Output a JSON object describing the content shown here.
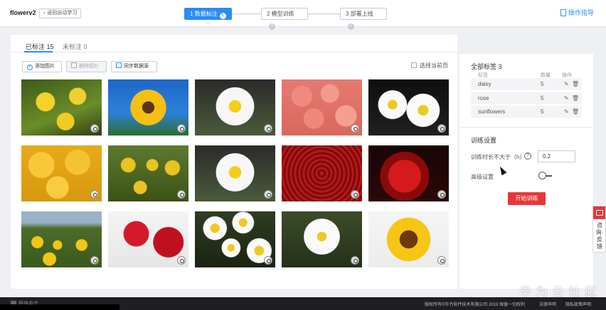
{
  "app": {
    "title": "flowerv2",
    "back_label": "返回自动学习"
  },
  "steps": [
    {
      "label": "1 数据标注",
      "state": "active"
    },
    {
      "label": "2 模型训练",
      "state": "idle"
    },
    {
      "label": "3 部署上线",
      "state": "idle"
    }
  ],
  "guide_label": "操作指导",
  "tabs": {
    "labeled": "已标注 15",
    "unlabeled": "未标注 0"
  },
  "toolbar": {
    "add": "添加图片",
    "delete": "删除图片",
    "sync": "同步数据源",
    "select_page": "选择当前页"
  },
  "images": [
    {
      "kind": "sunflower",
      "style": "t-sun2"
    },
    {
      "kind": "sunflower",
      "style": "t-sun"
    },
    {
      "kind": "daisy",
      "style": "t-daisy"
    },
    {
      "kind": "rose",
      "style": "t-rose-pink"
    },
    {
      "kind": "daisy",
      "style": "t-daisy2"
    },
    {
      "kind": "rose",
      "style": "t-rose-yellow"
    },
    {
      "kind": "sunflower",
      "style": "t-field2"
    },
    {
      "kind": "daisy",
      "style": "t-daisy"
    },
    {
      "kind": "rose",
      "style": "t-rose-red2"
    },
    {
      "kind": "rose",
      "style": "t-rose-dark"
    },
    {
      "kind": "sunflower",
      "style": "t-field"
    },
    {
      "kind": "rose",
      "style": "t-rose-white"
    },
    {
      "kind": "daisy",
      "style": "t-daisy3"
    },
    {
      "kind": "daisy",
      "style": "t-daisy-green"
    },
    {
      "kind": "sunflower",
      "style": "t-sunbig"
    }
  ],
  "labels_panel": {
    "title": "全部标签  3",
    "col_label": "标签",
    "col_count": "数量",
    "col_action": "操作",
    "rows": [
      {
        "name": "daisy",
        "count": "5"
      },
      {
        "name": "rose",
        "count": "5"
      },
      {
        "name": "sunflowers",
        "count": "5"
      }
    ]
  },
  "training": {
    "title": "训练设置",
    "duration_label": "训练时长不大于（h）",
    "duration_value": "0.2",
    "advanced_label": "高级设置",
    "start_label": "开始训练"
  },
  "consult": {
    "text": "咨询·反馈"
  },
  "footer": {
    "lang": "简体中文",
    "copyright": "版权所有©华为软件技术有限公司 2019 保留一切权利",
    "link1": "法律声明",
    "link2": "隐私政策声明"
  },
  "watermark": "华为云社区",
  "colors": {
    "accent": "#2a8df5",
    "danger": "#e8363a"
  }
}
